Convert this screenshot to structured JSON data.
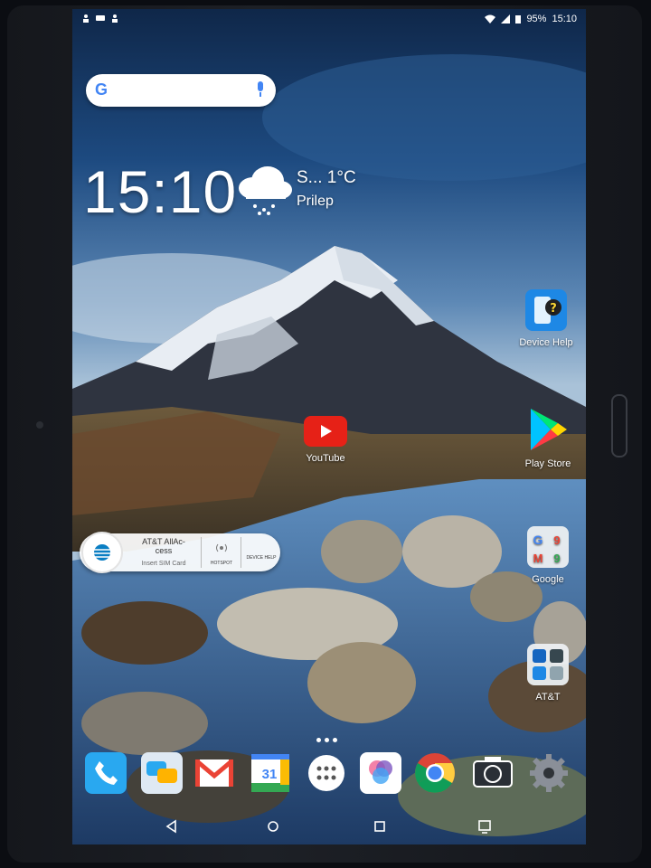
{
  "status_bar": {
    "battery": "95%",
    "time": "15:10"
  },
  "search": {
    "logo": "G"
  },
  "clock_widget": {
    "time": "15:10",
    "weather_summary": "S...",
    "temperature": "1°C",
    "location": "Prilep"
  },
  "apps": {
    "device_help": "Device Help",
    "youtube": "YouTube",
    "play_store": "Play Store",
    "google": "Google",
    "att": "AT&T"
  },
  "att_widget": {
    "title": "AT&T AllAc-\ncess",
    "subtitle": "Insert SIM Card",
    "hotspot": "HOTSPOT",
    "device_help": "DEVICE HELP"
  },
  "dock": {
    "calendar_day": "31"
  },
  "colors": {
    "sky_top": "#16345e",
    "accent_youtube": "#e62117",
    "device_help_blue": "#1e88e5"
  }
}
